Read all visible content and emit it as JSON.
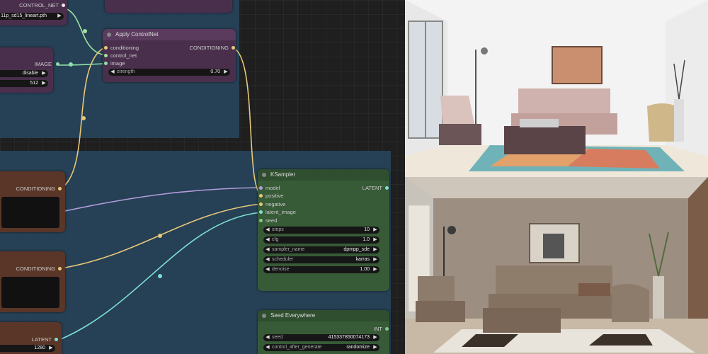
{
  "nodes": {
    "top_loader": {
      "output": "CONTROL_NET",
      "filename": "11p_sd15_lineart.pth"
    },
    "image_node": {
      "output": "IMAGE",
      "w1_value": "disable",
      "w2_value": "512"
    },
    "apply_controlnet": {
      "title": "Apply ControlNet",
      "inputs": [
        "conditioning",
        "control_net",
        "image"
      ],
      "output": "CONDITIONING",
      "strength_label": "strength",
      "strength_value": "0.70"
    },
    "cond_positive": {
      "output": "CONDITIONING"
    },
    "cond_negative": {
      "output": "CONDITIONING"
    },
    "latent_node": {
      "output": "LATENT",
      "w_value": "1280"
    },
    "ksampler": {
      "title": "KSampler",
      "inputs": [
        "model",
        "positive",
        "negative",
        "latent_image",
        "seed"
      ],
      "output": "LATENT",
      "widgets": [
        {
          "label": "steps",
          "value": "10"
        },
        {
          "label": "cfg",
          "value": "1.0"
        },
        {
          "label": "sampler_name",
          "value": "dpmpp_sde"
        },
        {
          "label": "scheduler",
          "value": "karras"
        },
        {
          "label": "denoise",
          "value": "1.00"
        }
      ]
    },
    "seed_everywhere": {
      "title": "Seed Everywhere",
      "output": "INT",
      "widgets": [
        {
          "label": "seed",
          "value": "415337850074173"
        },
        {
          "label": "control_after_generate",
          "value": "randomize"
        }
      ]
    }
  },
  "colors": {
    "conditioning_link": "#e8c87a",
    "model_link": "#b39ddb",
    "latent_link": "#7fe0d4",
    "controlnet_link": "#9fe29f",
    "image_link": "#8ee0a8"
  }
}
